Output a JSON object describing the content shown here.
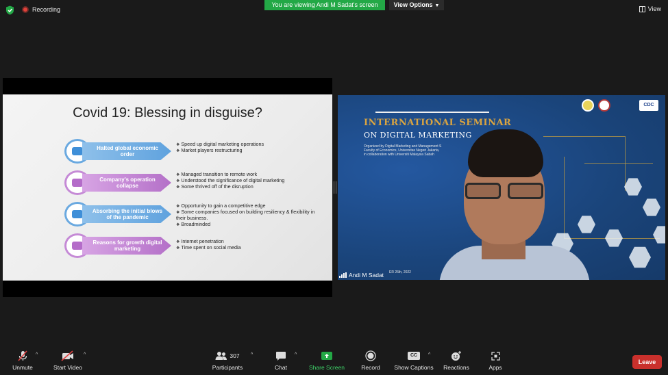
{
  "top_bar": {
    "recording_label": "Recording",
    "viewing_banner": "You are viewing Andi M Sadat's screen",
    "view_options_label": "View Options",
    "view_label": "View"
  },
  "slide": {
    "title": "Covid 19: Blessing in disguise?",
    "rows": [
      {
        "banner": "Halted global economic order",
        "bullets": [
          "Speed up digital marketing operations",
          "Market players restructuring"
        ]
      },
      {
        "banner": "Company's operation collapse",
        "bullets": [
          "Managed transition to remote work",
          "Understood the significance of digital marketing",
          "Some thrived off of the disruption"
        ]
      },
      {
        "banner": "Absorbing the initial blows of the pandemic",
        "bullets": [
          "Opportunity to gain a competitive edge",
          "Some companies focused on building resiliency & flexibility in their business.",
          "Broadminded"
        ]
      },
      {
        "banner": "Reasons for growth digital marketing",
        "bullets": [
          "Internet penetration",
          "Time spent on social media"
        ]
      }
    ]
  },
  "video": {
    "seminar_title_1": "INTERNATIONAL SEMINAR",
    "seminar_title_2": "ON DIGITAL MARKETING",
    "seminar_sub_1": "Organized by Digital Marketing and Management S",
    "seminar_sub_2": "Faculty of Economics, Universitas Negeri Jakarta,",
    "seminar_sub_3": "in collaboration with Universiti Malaysia Sabah",
    "logo_text": "CDC",
    "date_fragment": "ER 26th, 2022",
    "participant_name": "Andi M Sadat"
  },
  "toolbar": {
    "unmute": "Unmute",
    "start_video": "Start Video",
    "participants_count": "307",
    "participants": "Participants",
    "chat": "Chat",
    "share_screen": "Share Screen",
    "record": "Record",
    "show_captions": "Show Captions",
    "captions_icon_text": "CC",
    "reactions": "Reactions",
    "apps": "Apps",
    "leave": "Leave"
  },
  "colors": {
    "banner_green": "#23a846",
    "leave_red": "#c9302c",
    "seminar_gold": "#d9a441",
    "slide_blue": "#5fa2de",
    "slide_purple": "#b470c8"
  }
}
